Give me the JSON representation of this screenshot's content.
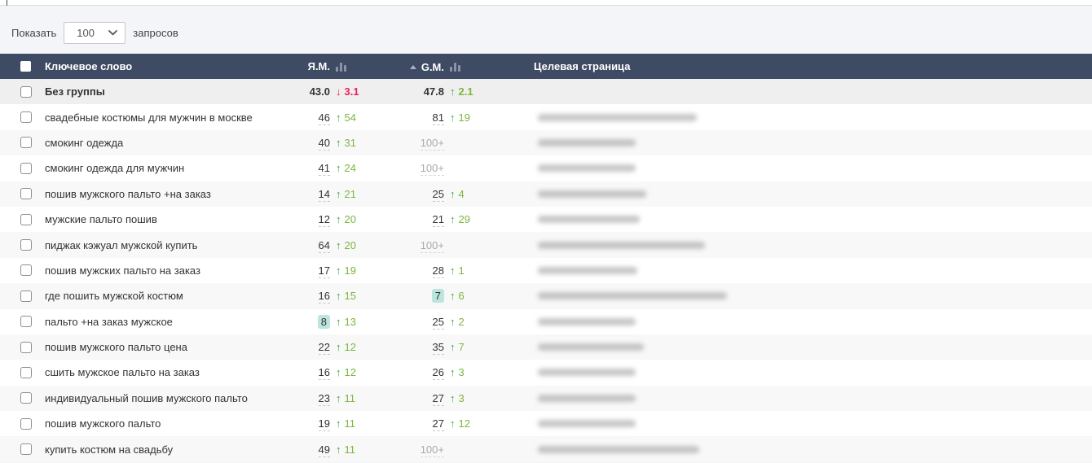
{
  "icons": {
    "up_arrow": "↑",
    "down_arrow": "↓",
    "bar_chart": "bar-chart-icon",
    "sort_asc": "sort-asc-icon",
    "chevron_down": "chevron-down-icon"
  },
  "colors": {
    "header_bg": "#3f4b64",
    "up_green": "#43a443",
    "up_value_green": "#7cb63d",
    "down_red": "#ec2158",
    "badge_bg": "#bce5de",
    "page_bg": "#f4f5f9"
  },
  "controls": {
    "show_label": "Показать",
    "page_size_value": "100",
    "suffix_label": "запросов"
  },
  "table": {
    "header": {
      "keyword": "Ключевое слово",
      "ym": "Я.М.",
      "gm": "G.M.",
      "target": "Целевая страница"
    },
    "rows": [
      {
        "keyword": "Без группы",
        "group": true,
        "ym": "43.0",
        "ym_dir": "down",
        "ym_change": "3.1",
        "gm": "47.8",
        "gm_dir": "up",
        "gm_change": "2.1",
        "blur": 0
      },
      {
        "keyword": "свадебные костюмы для мужчин в москве",
        "ym": "46",
        "ym_dir": "up",
        "ym_change": "54",
        "gm": "81",
        "gm_dir": "up",
        "gm_change": "19",
        "blur": 195
      },
      {
        "keyword": "смокинг одежда",
        "ym": "40",
        "ym_dir": "up",
        "ym_change": "31",
        "gm": "100+",
        "blur": 120
      },
      {
        "keyword": "смокинг одежда для мужчин",
        "ym": "41",
        "ym_dir": "up",
        "ym_change": "24",
        "gm": "100+",
        "blur": 120
      },
      {
        "keyword": "пошив мужского пальто +на заказ",
        "ym": "14",
        "ym_dir": "up",
        "ym_change": "21",
        "gm": "25",
        "gm_dir": "up",
        "gm_change": "4",
        "blur": 133
      },
      {
        "keyword": "мужские пальто пошив",
        "ym": "12",
        "ym_dir": "up",
        "ym_change": "20",
        "gm": "21",
        "gm_dir": "up",
        "gm_change": "29",
        "blur": 125
      },
      {
        "keyword": "пиджак кэжуал мужской купить",
        "ym": "64",
        "ym_dir": "up",
        "ym_change": "20",
        "gm": "100+",
        "blur": 205
      },
      {
        "keyword": "пошив мужских пальто на заказ",
        "ym": "17",
        "ym_dir": "up",
        "ym_change": "19",
        "gm": "28",
        "gm_dir": "up",
        "gm_change": "1",
        "blur": 122
      },
      {
        "keyword": "где пошить мужской костюм",
        "ym": "16",
        "ym_dir": "up",
        "ym_change": "15",
        "gm": "7",
        "gm_badge": true,
        "gm_dir": "up",
        "gm_change": "6",
        "blur": 232
      },
      {
        "keyword": "пальто +на заказ мужское",
        "ym": "8",
        "ym_badge": true,
        "ym_dir": "up",
        "ym_change": "13",
        "gm": "25",
        "gm_dir": "up",
        "gm_change": "2",
        "blur": 120
      },
      {
        "keyword": "пошив мужского пальто цена",
        "ym": "22",
        "ym_dir": "up",
        "ym_change": "12",
        "gm": "35",
        "gm_dir": "up",
        "gm_change": "7",
        "blur": 130
      },
      {
        "keyword": "сшить мужское пальто на заказ",
        "ym": "16",
        "ym_dir": "up",
        "ym_change": "12",
        "gm": "26",
        "gm_dir": "up",
        "gm_change": "3",
        "blur": 120
      },
      {
        "keyword": "индивидуальный пошив мужского пальто",
        "ym": "23",
        "ym_dir": "up",
        "ym_change": "11",
        "gm": "27",
        "gm_dir": "up",
        "gm_change": "3",
        "blur": 120
      },
      {
        "keyword": "пошив мужского пальто",
        "ym": "19",
        "ym_dir": "up",
        "ym_change": "11",
        "gm": "27",
        "gm_dir": "up",
        "gm_change": "12",
        "blur": 120
      },
      {
        "keyword": "купить костюм на свадьбу",
        "ym": "49",
        "ym_dir": "up",
        "ym_change": "11",
        "gm": "100+",
        "blur": 198
      }
    ]
  }
}
